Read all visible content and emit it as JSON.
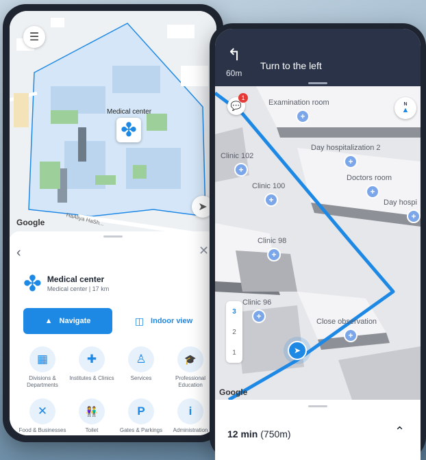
{
  "left": {
    "map": {
      "place_label": "Medical center",
      "street": "HaAliya HaSh...",
      "google": "Google"
    },
    "sheet": {
      "back_icon": "chevron-left-icon",
      "close_icon": "close-icon",
      "title": "Medical center",
      "subtitle": "Medical center  |  17 km",
      "navigate_label": "Navigate",
      "indoor_label": "Indoor view",
      "categories": [
        {
          "label": "Divisions & Departments",
          "icon": "building-icon",
          "glyph": "▦"
        },
        {
          "label": "Institutes & Clinics",
          "icon": "medkit-icon",
          "glyph": "✚"
        },
        {
          "label": "Services",
          "icon": "services-icon",
          "glyph": "♙"
        },
        {
          "label": "Professional Education",
          "icon": "graduation-icon",
          "glyph": "🎓"
        },
        {
          "label": "Food & Businesses",
          "icon": "food-icon",
          "glyph": "✕"
        },
        {
          "label": "Toilet",
          "icon": "toilet-icon",
          "glyph": "👫"
        },
        {
          "label": "Gates & Parkings",
          "icon": "parking-icon",
          "glyph": "P"
        },
        {
          "label": "Administration",
          "icon": "info-icon",
          "glyph": "i"
        }
      ]
    }
  },
  "right": {
    "nav": {
      "instruction": "Turn to the left",
      "distance": "60m"
    },
    "badge_count": "1",
    "compass_label": "N",
    "google": "Google",
    "rooms": [
      {
        "label": "Examination room"
      },
      {
        "label": "Day hospitalization 2"
      },
      {
        "label": "Clinic 102"
      },
      {
        "label": "Doctors room"
      },
      {
        "label": "Clinic 100"
      },
      {
        "label": "Day hospi"
      },
      {
        "label": "Clinic 98"
      },
      {
        "label": "Clinic 96"
      },
      {
        "label": "Close observation"
      }
    ],
    "floors": [
      "3",
      "2",
      "1"
    ],
    "active_floor": "3",
    "eta_time": "12 min",
    "eta_distance": "(750m)"
  }
}
